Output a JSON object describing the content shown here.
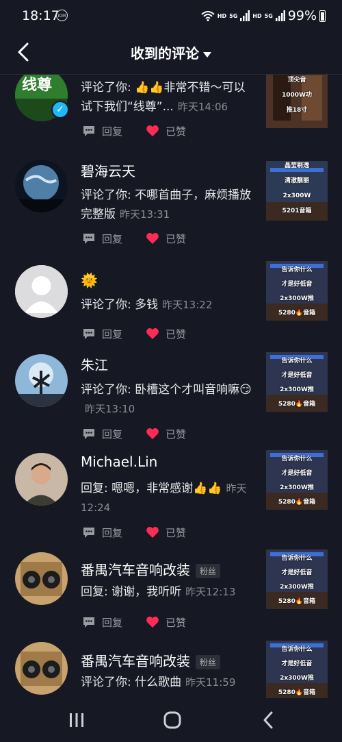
{
  "status_bar": {
    "time": "18:17",
    "idm": "IDM",
    "hd1": "HD",
    "hd2": "HD",
    "five_g1": "5G",
    "five_g2": "5G",
    "battery": "99%"
  },
  "header": {
    "title": "收到的评论"
  },
  "actions": {
    "reply": "回复",
    "liked": "已赞"
  },
  "comments": [
    {
      "name": "",
      "text": "评论了你: 👍👍非常不错～可以试下我们“线尊”...",
      "time": "昨天14:06",
      "avatar_text": "线尊",
      "thumb_lines": [
        "顶尖音",
        "1000W功",
        "推18寸"
      ]
    },
    {
      "name": "碧海云天",
      "text": "评论了你: 不哪首曲子，麻烦播放完整版",
      "time": "昨天13:31",
      "thumb_lines": [
        "晶莹剔透",
        "清澈靓丽",
        "2x300W",
        "5201音箱"
      ]
    },
    {
      "name": "🌞",
      "text": "评论了你: 多钱",
      "time": "昨天13:22",
      "thumb_lines": [
        "告诉你什么",
        "才是好低音",
        "2x300W推",
        "5280🔥音箱"
      ]
    },
    {
      "name": "朱江",
      "text": "评论了你: 卧槽这个才叫音响嘛😏",
      "time": "昨天13:10",
      "thumb_lines": [
        "告诉你什么",
        "才是好低音",
        "2x300W推",
        "5280🔥音箱"
      ]
    },
    {
      "name": "Michael.Lin",
      "text": "回复: 嗯嗯，非常感谢👍👍",
      "time": "昨天12:24",
      "thumb_lines": [
        "告诉你什么",
        "才是好低音",
        "2x300W推",
        "5280🔥音箱"
      ]
    },
    {
      "name": "番禺汽车音响改装",
      "badge": "粉丝",
      "text": "回复: 谢谢，我听听",
      "time": "昨天12:13",
      "thumb_lines": [
        "告诉你什么",
        "才是好低音",
        "2x300W推",
        "5280🔥音箱"
      ]
    },
    {
      "name": "番禺汽车音响改装",
      "badge": "粉丝",
      "text": "评论了你: 什么歌曲",
      "time": "昨天11:59",
      "thumb_lines": [
        "告诉你什么",
        "才是好低音",
        "2x300W推",
        "5280🔥音箱"
      ]
    }
  ],
  "colors": {
    "background": "#161823",
    "heart": "#fe2c55",
    "verify": "#20b9f7"
  }
}
